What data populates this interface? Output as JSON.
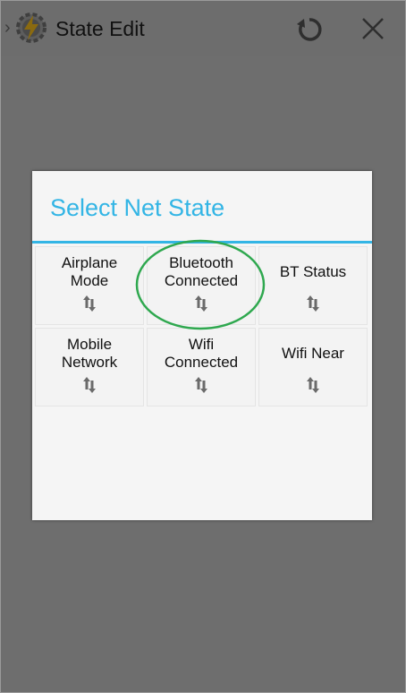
{
  "actionbar": {
    "title": "State Edit",
    "icons": [
      "back-chevron-icon",
      "app-icon",
      "undo-icon",
      "close-icon"
    ]
  },
  "dialog": {
    "title": "Select Net State",
    "accent_color": "#33b5e5",
    "items": [
      {
        "label": "Airplane\nMode"
      },
      {
        "label": "Bluetooth\nConnected"
      },
      {
        "label": "BT Status"
      },
      {
        "label": "Mobile\nNetwork"
      },
      {
        "label": "Wifi\nConnected"
      },
      {
        "label": "Wifi Near"
      }
    ],
    "item_icon": "up-down-arrows-icon"
  },
  "annotation": {
    "highlighted_item": "Bluetooth\nConnected",
    "color": "#2fa84f"
  }
}
